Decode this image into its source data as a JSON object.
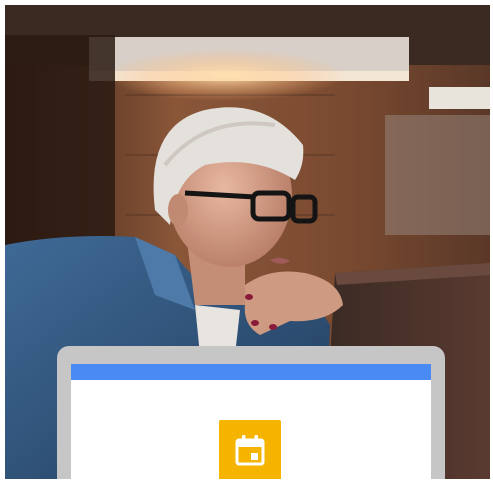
{
  "colors": {
    "accent_bar": "#4a8af4",
    "app_tile": "#f4b400",
    "mockup_bezel": "#c6c6c6",
    "screen_bg": "#ffffff",
    "icon_fg": "#ffffff"
  },
  "icons": {
    "app_tile_icon": "calendar-icon"
  }
}
